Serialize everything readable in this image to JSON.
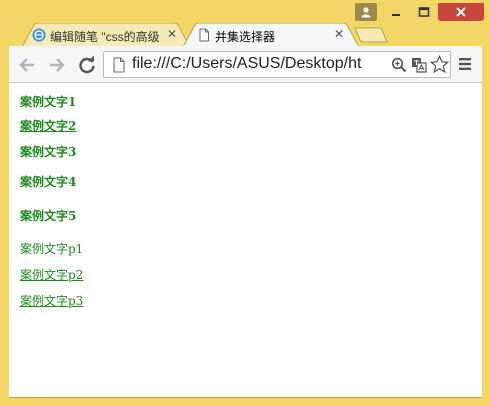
{
  "window": {
    "frame_color": "#f2d766",
    "close_color": "#c9463d"
  },
  "tabs": [
    {
      "title": "编辑随笔 \"css的高级",
      "favicon": "blog-favicon",
      "active": false
    },
    {
      "title": "并集选择器",
      "favicon": "page-icon",
      "active": true
    }
  ],
  "toolbar": {
    "url": "file:///C:/Users/ASUS/Desktop/ht"
  },
  "content": {
    "text_color": "#1c8a1c",
    "headings": [
      "案例文字1",
      "案例文字2",
      "案例文字3",
      "案例文字4",
      "案例文字5"
    ],
    "paragraphs": [
      "案例文字p1",
      "案例文字p2",
      "案例文字p3"
    ]
  }
}
